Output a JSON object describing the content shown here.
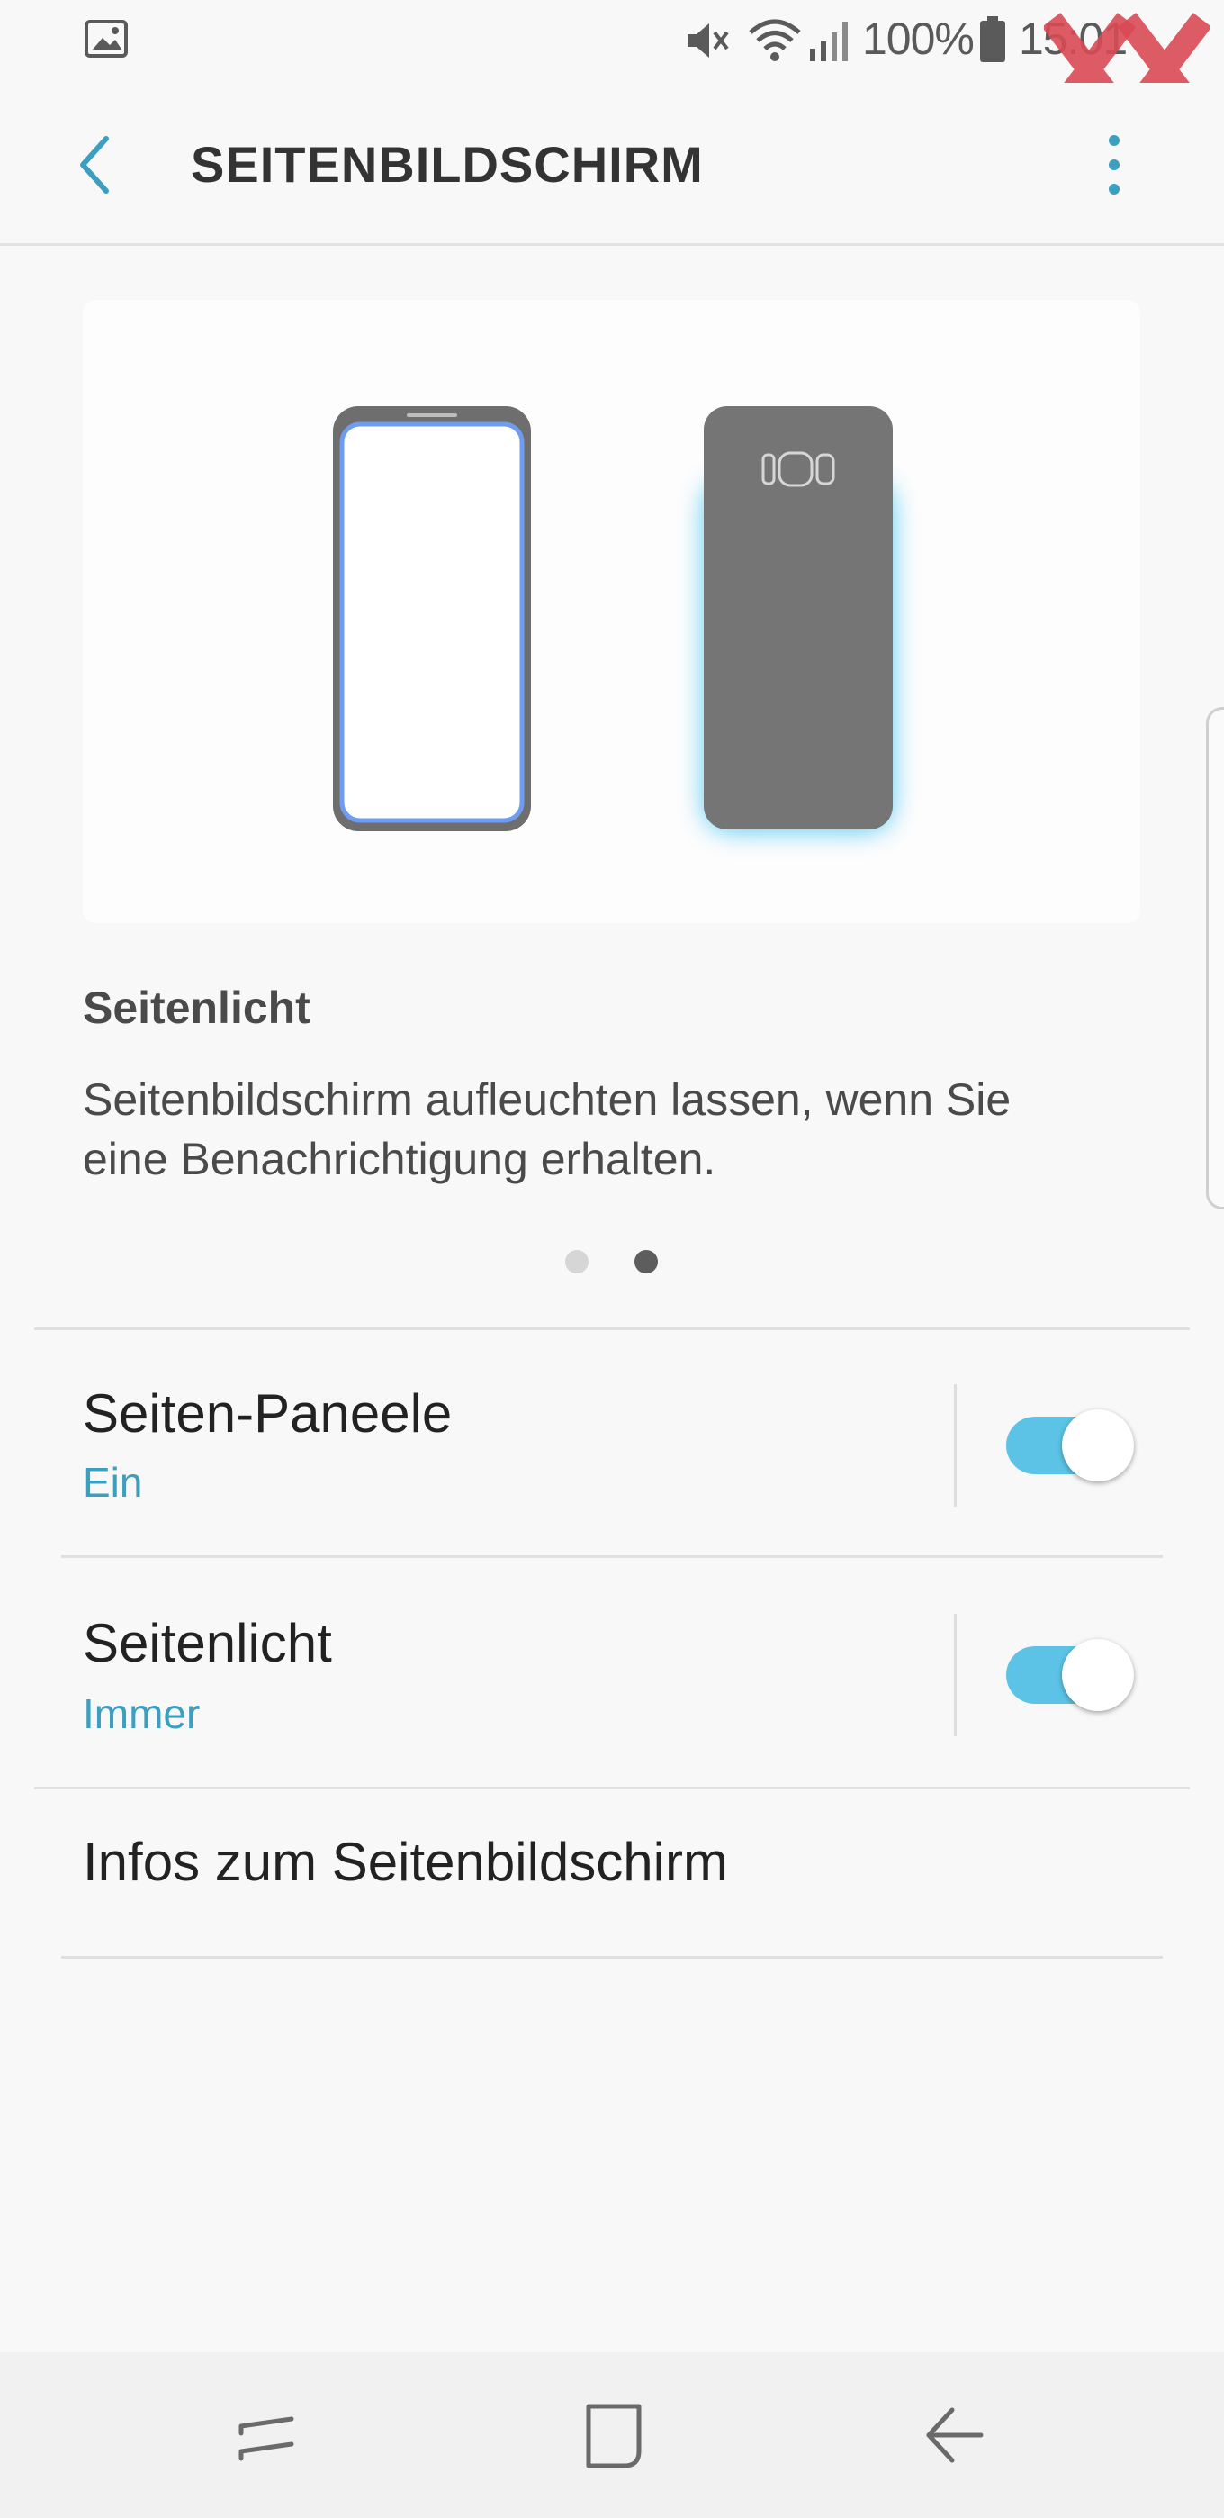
{
  "status_bar": {
    "battery": "100%",
    "time": "15:01",
    "icons": [
      "image-icon",
      "mute-icon",
      "wifi-icon",
      "signal-icon",
      "battery-icon"
    ]
  },
  "header": {
    "title": "SEITENBILDSCHIRM",
    "back_icon": "back-arrow-icon",
    "menu_icon": "more-vertical-icon"
  },
  "watermark": {
    "logo": "XX"
  },
  "slide": {
    "title": "Seitenlicht",
    "description_line1": "Seitenbildschirm aufleuchten lassen, wenn Sie",
    "description_line2": "eine Benachrichtigung erhalten.",
    "pager": {
      "count": 2,
      "active": 2
    }
  },
  "settings": [
    {
      "title": "Seiten-Paneele",
      "subtitle": "Ein",
      "toggle_on": true
    },
    {
      "title": "Seitenlicht",
      "subtitle": "Immer",
      "toggle_on": true
    }
  ],
  "info_item": {
    "title": "Infos zum Seitenbildschirm"
  },
  "nav_bar": {
    "icons": [
      "recents-icon",
      "home-icon",
      "back-icon"
    ]
  },
  "colors": {
    "accent": "#3d9fc0",
    "toggle_on": "#5cc3e6",
    "edge_glow": "#3ec1f0"
  }
}
